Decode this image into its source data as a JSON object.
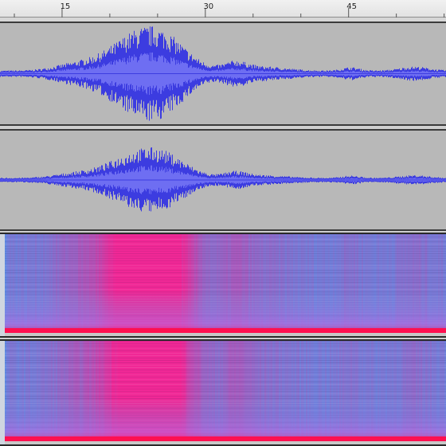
{
  "timeline": {
    "ticks": [
      "15",
      "30",
      "45"
    ],
    "tick_seconds": [
      15,
      30,
      45
    ],
    "visible_seconds": [
      8.5,
      55.2
    ]
  },
  "tracks": [
    {
      "kind": "waveform",
      "channel": "left"
    },
    {
      "kind": "waveform",
      "channel": "right"
    },
    {
      "kind": "spectrogram",
      "channel": "left"
    },
    {
      "kind": "spectrogram",
      "channel": "right"
    }
  ],
  "colors": {
    "waveform": "#3c3ce0",
    "waveform_rms": "#6e6ef2",
    "track_background": "#b8b8b8",
    "spectrogram_low": "#5a8fe6",
    "spectrogram_mid": "#b46ee8",
    "spectrogram_high": "#f0277d",
    "spectrogram_peak": "#ff1050"
  }
}
